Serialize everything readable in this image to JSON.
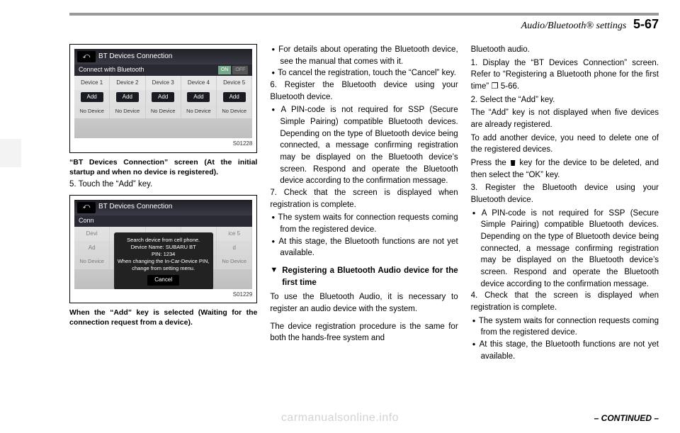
{
  "header": {
    "title": "Audio/Bluetooth® settings",
    "page": "5-67"
  },
  "tab_edge": "",
  "col1": {
    "fig1": {
      "code": "S01228",
      "title": "BT Devices Connection",
      "sub": "Connect with Bluetooth",
      "on": "ON",
      "off": "OFF",
      "devices": [
        "Device 1",
        "Device 2",
        "Device 3",
        "Device 4",
        "Device 5"
      ],
      "add": "Add",
      "nodevice": "No Device"
    },
    "caption1": "“BT Devices Connection” screen (At the initial startup and when no device is registered).",
    "step5": "5.  Touch the “Add” key.",
    "fig2": {
      "code": "S01229",
      "title": "BT Devices Connection",
      "sub": "Conn",
      "modal_l1": "Search device from cell phone.",
      "modal_l2": "Device Name: SUBARU BT",
      "modal_l3": "PIN: 1234",
      "modal_l4": "When changing the In-Car-Device PIN,",
      "modal_l5": "change from setting menu.",
      "cancel": "Cancel",
      "dev_left": "Devi",
      "dev_right": "ice 5",
      "add_left": "Ad",
      "add_right": "d",
      "nodevice": "No Device"
    },
    "caption2": "When the “Add” key is selected (Waiting for the connection request from a device)."
  },
  "col2": {
    "b1": "For details about operating the Bluetooth device, see the manual that comes with it.",
    "b2": "To cancel the registration, touch the “Cancel” key.",
    "p6": "6.  Register the Bluetooth device using your Bluetooth device.",
    "b3": "A PIN-code is not required for SSP (Secure Simple Pairing) compatible Bluetooth devices. Depending on the type of Bluetooth device being connected, a message confirming registration may be displayed on the Bluetooth device’s screen. Respond and operate the Bluetooth device according to the confirmation message.",
    "p7": "7.  Check that the screen is displayed when registration is complete.",
    "b4": "The system waits for connection requests coming from the registered device.",
    "b5": "At this stage, the Bluetooth functions are not yet available.",
    "sub_tri": "▼",
    "sub_txt": "Registering a Bluetooth Audio device for the first time",
    "p8": "To use the Bluetooth Audio, it is necessary to register an audio device with the system.",
    "p9": "The device registration procedure is the same for both the hands-free system and"
  },
  "col3": {
    "p0": "Bluetooth audio.",
    "p1": "1.  Display the “BT Devices Connection” screen. Refer to “Registering a Bluetooth phone for the first time” ❐ 5-66.",
    "p2": "2.  Select the “Add” key.",
    "p3": "The “Add” key is not displayed when five devices are already registered.",
    "p4": "To add another device, you need to delete one of the registered devices.",
    "p5a": "Press the ",
    "p5b": " key for the device to be deleted, and then select the “OK” key.",
    "p6": "3.  Register the Bluetooth device using your Bluetooth device.",
    "b1": "A PIN-code is not required for SSP (Secure Simple Pairing) compatible Bluetooth devices. Depending on the type of Bluetooth device being connected, a message confirming registration may be displayed on the Bluetooth device’s screen. Respond and operate the Bluetooth device according to the confirmation message.",
    "p7": "4.  Check that the screen is displayed when registration is complete.",
    "b2": "The system waits for connection requests coming from the registered device.",
    "b3": "At this stage, the Bluetooth functions are not yet available."
  },
  "continued": "– CONTINUED –",
  "watermark": "carmanualsonline.info"
}
